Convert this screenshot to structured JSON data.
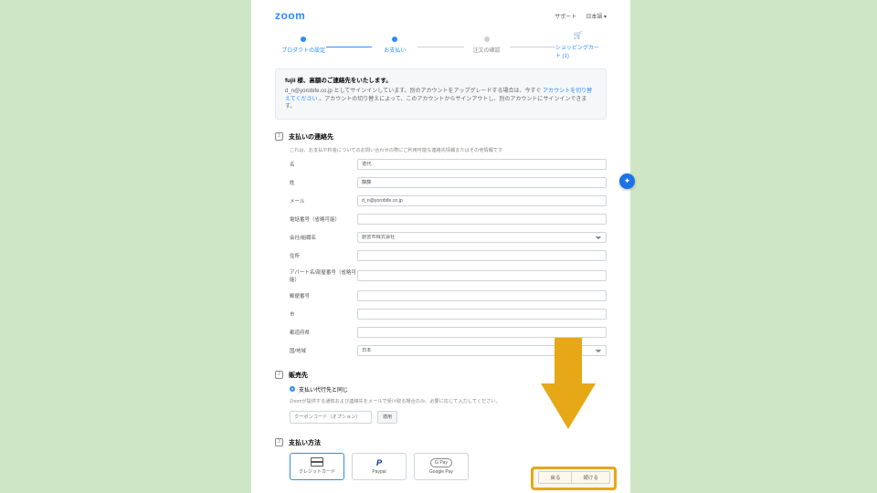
{
  "brand": "zoom",
  "header": {
    "support": "サポート",
    "language": "日本語 ▾"
  },
  "stepper": {
    "step1": "プロダクトの設定",
    "step2": "お支払い",
    "step3": "注文の確認",
    "cart": "ショッピングカート (1)"
  },
  "notice": {
    "bold": "fujii 様、高額のご連絡先をいたします。",
    "body_prefix": "d_n@yorobife.co.jp としてサインインしています。別のアカウントをアップグレードする場合は、今すぐ",
    "body_link": "アカウントを切り替えてください",
    "body_suffix": "。アカウントの切り替えによって、このアカウントからサインアウトし、別のアカウントにサインインできます。"
  },
  "section1": {
    "num": "1",
    "title": "支払いの連絡先",
    "sub": "これは、お支払や料金についてのお問い合わせの際にご利用可能な連絡先情報またはその他情報です",
    "fields": {
      "lastname_label": "名",
      "lastname_value": "道代",
      "firstname_label": "姓",
      "firstname_value": "藤藤",
      "email_label": "メール",
      "email_value": "d_n@yorobife.co.jp",
      "phone_label": "電話番号（省略可能）",
      "phone_value": "",
      "company_label": "会社/組織名",
      "company_value": "創芸市株式会社",
      "address_label": "住所",
      "address_value": "",
      "apt_label": "アパート名/部屋番号（省略可能）",
      "apt_value": "",
      "zip_label": "郵便番号",
      "zip_value": "",
      "city_label": "市",
      "city_value": "",
      "state_label": "都道府県",
      "state_value": "",
      "country_label": "国/地域",
      "country_value": "日本"
    }
  },
  "section2": {
    "num": "2",
    "title": "販売先",
    "radio": "支払い代行先と同じ",
    "note": "Zoomが提供する通知および連絡先をメールで受け取る場合のみ、必要に応じて入力してください。",
    "coupon_placeholder": "クーポンコード（オプション）",
    "apply": "適用"
  },
  "section3": {
    "num": "3",
    "title": "支払い方法",
    "cards": {
      "credit": "クレジットカード",
      "paypal": "Paypal",
      "gpay": "Google Pay"
    }
  },
  "footer": {
    "back": "戻る",
    "next": "続ける"
  }
}
